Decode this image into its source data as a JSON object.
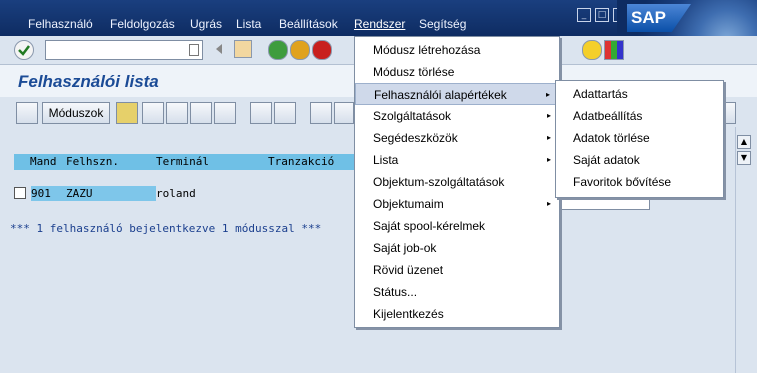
{
  "menubar": {
    "items": [
      {
        "label": "Felhasználó"
      },
      {
        "label": "Feldolgozás"
      },
      {
        "label": "Ugrás"
      },
      {
        "label": "Lista"
      },
      {
        "label": "Beállítások"
      },
      {
        "label": "Rendszer"
      },
      {
        "label": "Segítség"
      }
    ],
    "logo": "SAP"
  },
  "title": "Felhasználói lista",
  "app_toolbar": {
    "moduszok_label": "Móduszok"
  },
  "list": {
    "headers": [
      "Mand",
      "Felhszn.",
      "Terminál",
      "Tranzakció"
    ],
    "rows": [
      {
        "mand": "901",
        "user": "ZAZU",
        "terminal": "roland"
      }
    ],
    "summary": "*** 1 felhasználó bejelentkezve 1 módusszal ***"
  },
  "menu_rendszer": {
    "items": [
      {
        "label": "Módusz létrehozása"
      },
      {
        "label": "Módusz törlése"
      },
      {
        "label": "Felhasználói alapértékek",
        "arrow": "▸"
      },
      {
        "label": "Szolgáltatások",
        "arrow": "▸"
      },
      {
        "label": "Segédeszközök",
        "arrow": "▸"
      },
      {
        "label": "Lista",
        "arrow": "▸"
      },
      {
        "label": "Objektum-szolgáltatások"
      },
      {
        "label": "Objektumaim",
        "arrow": "▸"
      },
      {
        "label": "Saját spool-kérelmek"
      },
      {
        "label": "Saját job-ok"
      },
      {
        "label": "Rövid üzenet"
      },
      {
        "label": "Státus..."
      },
      {
        "label": "Kijelentkezés"
      }
    ]
  },
  "submenu_alapertekek": {
    "items": [
      {
        "label": "Adattartás"
      },
      {
        "label": "Adatbeállítás"
      },
      {
        "label": "Adatok törlése"
      },
      {
        "label": "Saját adatok"
      },
      {
        "label": "Favoritok bővítése"
      }
    ]
  },
  "colors": {
    "accent": "#1b4b96",
    "menubar": "#0e2c62",
    "list_header": "#6fc0e6"
  }
}
